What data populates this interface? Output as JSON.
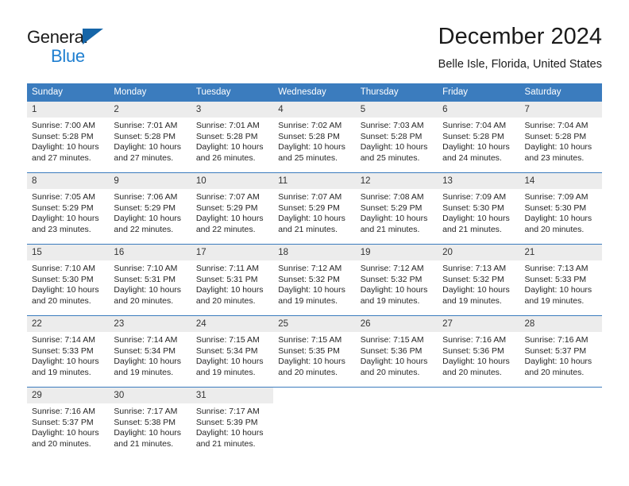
{
  "brand": {
    "name_part1": "General",
    "name_part2": "Blue",
    "triangle_color": "#1565a8",
    "blue_text_color": "#1f7fd0"
  },
  "header": {
    "title": "December 2024",
    "subtitle": "Belle Isle, Florida, United States"
  },
  "calendar": {
    "header_bg": "#3b7cbe",
    "daynum_bg": "#ececec",
    "weekday_headers": [
      "Sunday",
      "Monday",
      "Tuesday",
      "Wednesday",
      "Thursday",
      "Friday",
      "Saturday"
    ],
    "weeks": [
      [
        {
          "day": "1",
          "sunrise": "Sunrise: 7:00 AM",
          "sunset": "Sunset: 5:28 PM",
          "daylight_line1": "Daylight: 10 hours",
          "daylight_line2": "and 27 minutes."
        },
        {
          "day": "2",
          "sunrise": "Sunrise: 7:01 AM",
          "sunset": "Sunset: 5:28 PM",
          "daylight_line1": "Daylight: 10 hours",
          "daylight_line2": "and 27 minutes."
        },
        {
          "day": "3",
          "sunrise": "Sunrise: 7:01 AM",
          "sunset": "Sunset: 5:28 PM",
          "daylight_line1": "Daylight: 10 hours",
          "daylight_line2": "and 26 minutes."
        },
        {
          "day": "4",
          "sunrise": "Sunrise: 7:02 AM",
          "sunset": "Sunset: 5:28 PM",
          "daylight_line1": "Daylight: 10 hours",
          "daylight_line2": "and 25 minutes."
        },
        {
          "day": "5",
          "sunrise": "Sunrise: 7:03 AM",
          "sunset": "Sunset: 5:28 PM",
          "daylight_line1": "Daylight: 10 hours",
          "daylight_line2": "and 25 minutes."
        },
        {
          "day": "6",
          "sunrise": "Sunrise: 7:04 AM",
          "sunset": "Sunset: 5:28 PM",
          "daylight_line1": "Daylight: 10 hours",
          "daylight_line2": "and 24 minutes."
        },
        {
          "day": "7",
          "sunrise": "Sunrise: 7:04 AM",
          "sunset": "Sunset: 5:28 PM",
          "daylight_line1": "Daylight: 10 hours",
          "daylight_line2": "and 23 minutes."
        }
      ],
      [
        {
          "day": "8",
          "sunrise": "Sunrise: 7:05 AM",
          "sunset": "Sunset: 5:29 PM",
          "daylight_line1": "Daylight: 10 hours",
          "daylight_line2": "and 23 minutes."
        },
        {
          "day": "9",
          "sunrise": "Sunrise: 7:06 AM",
          "sunset": "Sunset: 5:29 PM",
          "daylight_line1": "Daylight: 10 hours",
          "daylight_line2": "and 22 minutes."
        },
        {
          "day": "10",
          "sunrise": "Sunrise: 7:07 AM",
          "sunset": "Sunset: 5:29 PM",
          "daylight_line1": "Daylight: 10 hours",
          "daylight_line2": "and 22 minutes."
        },
        {
          "day": "11",
          "sunrise": "Sunrise: 7:07 AM",
          "sunset": "Sunset: 5:29 PM",
          "daylight_line1": "Daylight: 10 hours",
          "daylight_line2": "and 21 minutes."
        },
        {
          "day": "12",
          "sunrise": "Sunrise: 7:08 AM",
          "sunset": "Sunset: 5:29 PM",
          "daylight_line1": "Daylight: 10 hours",
          "daylight_line2": "and 21 minutes."
        },
        {
          "day": "13",
          "sunrise": "Sunrise: 7:09 AM",
          "sunset": "Sunset: 5:30 PM",
          "daylight_line1": "Daylight: 10 hours",
          "daylight_line2": "and 21 minutes."
        },
        {
          "day": "14",
          "sunrise": "Sunrise: 7:09 AM",
          "sunset": "Sunset: 5:30 PM",
          "daylight_line1": "Daylight: 10 hours",
          "daylight_line2": "and 20 minutes."
        }
      ],
      [
        {
          "day": "15",
          "sunrise": "Sunrise: 7:10 AM",
          "sunset": "Sunset: 5:30 PM",
          "daylight_line1": "Daylight: 10 hours",
          "daylight_line2": "and 20 minutes."
        },
        {
          "day": "16",
          "sunrise": "Sunrise: 7:10 AM",
          "sunset": "Sunset: 5:31 PM",
          "daylight_line1": "Daylight: 10 hours",
          "daylight_line2": "and 20 minutes."
        },
        {
          "day": "17",
          "sunrise": "Sunrise: 7:11 AM",
          "sunset": "Sunset: 5:31 PM",
          "daylight_line1": "Daylight: 10 hours",
          "daylight_line2": "and 20 minutes."
        },
        {
          "day": "18",
          "sunrise": "Sunrise: 7:12 AM",
          "sunset": "Sunset: 5:32 PM",
          "daylight_line1": "Daylight: 10 hours",
          "daylight_line2": "and 19 minutes."
        },
        {
          "day": "19",
          "sunrise": "Sunrise: 7:12 AM",
          "sunset": "Sunset: 5:32 PM",
          "daylight_line1": "Daylight: 10 hours",
          "daylight_line2": "and 19 minutes."
        },
        {
          "day": "20",
          "sunrise": "Sunrise: 7:13 AM",
          "sunset": "Sunset: 5:32 PM",
          "daylight_line1": "Daylight: 10 hours",
          "daylight_line2": "and 19 minutes."
        },
        {
          "day": "21",
          "sunrise": "Sunrise: 7:13 AM",
          "sunset": "Sunset: 5:33 PM",
          "daylight_line1": "Daylight: 10 hours",
          "daylight_line2": "and 19 minutes."
        }
      ],
      [
        {
          "day": "22",
          "sunrise": "Sunrise: 7:14 AM",
          "sunset": "Sunset: 5:33 PM",
          "daylight_line1": "Daylight: 10 hours",
          "daylight_line2": "and 19 minutes."
        },
        {
          "day": "23",
          "sunrise": "Sunrise: 7:14 AM",
          "sunset": "Sunset: 5:34 PM",
          "daylight_line1": "Daylight: 10 hours",
          "daylight_line2": "and 19 minutes."
        },
        {
          "day": "24",
          "sunrise": "Sunrise: 7:15 AM",
          "sunset": "Sunset: 5:34 PM",
          "daylight_line1": "Daylight: 10 hours",
          "daylight_line2": "and 19 minutes."
        },
        {
          "day": "25",
          "sunrise": "Sunrise: 7:15 AM",
          "sunset": "Sunset: 5:35 PM",
          "daylight_line1": "Daylight: 10 hours",
          "daylight_line2": "and 20 minutes."
        },
        {
          "day": "26",
          "sunrise": "Sunrise: 7:15 AM",
          "sunset": "Sunset: 5:36 PM",
          "daylight_line1": "Daylight: 10 hours",
          "daylight_line2": "and 20 minutes."
        },
        {
          "day": "27",
          "sunrise": "Sunrise: 7:16 AM",
          "sunset": "Sunset: 5:36 PM",
          "daylight_line1": "Daylight: 10 hours",
          "daylight_line2": "and 20 minutes."
        },
        {
          "day": "28",
          "sunrise": "Sunrise: 7:16 AM",
          "sunset": "Sunset: 5:37 PM",
          "daylight_line1": "Daylight: 10 hours",
          "daylight_line2": "and 20 minutes."
        }
      ],
      [
        {
          "day": "29",
          "sunrise": "Sunrise: 7:16 AM",
          "sunset": "Sunset: 5:37 PM",
          "daylight_line1": "Daylight: 10 hours",
          "daylight_line2": "and 20 minutes."
        },
        {
          "day": "30",
          "sunrise": "Sunrise: 7:17 AM",
          "sunset": "Sunset: 5:38 PM",
          "daylight_line1": "Daylight: 10 hours",
          "daylight_line2": "and 21 minutes."
        },
        {
          "day": "31",
          "sunrise": "Sunrise: 7:17 AM",
          "sunset": "Sunset: 5:39 PM",
          "daylight_line1": "Daylight: 10 hours",
          "daylight_line2": "and 21 minutes."
        },
        {
          "day": "",
          "sunrise": "",
          "sunset": "",
          "daylight_line1": "",
          "daylight_line2": ""
        },
        {
          "day": "",
          "sunrise": "",
          "sunset": "",
          "daylight_line1": "",
          "daylight_line2": ""
        },
        {
          "day": "",
          "sunrise": "",
          "sunset": "",
          "daylight_line1": "",
          "daylight_line2": ""
        },
        {
          "day": "",
          "sunrise": "",
          "sunset": "",
          "daylight_line1": "",
          "daylight_line2": ""
        }
      ]
    ]
  }
}
